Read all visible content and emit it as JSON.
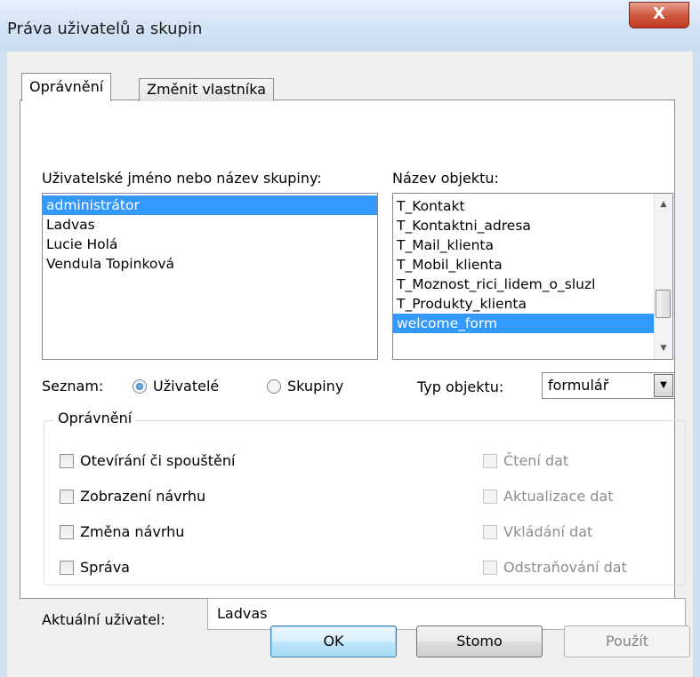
{
  "window": {
    "title": "Práva uživatelů a skupin",
    "close_glyph": "X"
  },
  "tabs": [
    {
      "label": "Oprávnění",
      "active": true
    },
    {
      "label": "Změnit vlastníka",
      "active": false
    }
  ],
  "users": {
    "label": "Uživatelské jméno nebo název skupiny:",
    "items": [
      "administrátor",
      "Ladvas",
      "Lucie Holá",
      "Vendula Topinková"
    ],
    "selected_index": 0
  },
  "objects": {
    "label": "Název objektu:",
    "items": [
      "T_Kontakt",
      "T_Kontaktni_adresa",
      "T_Mail_klienta",
      "T_Mobil_klienta",
      "T_Moznost_rici_lidem_o_sluzl",
      "T_Produkty_klienta",
      "welcome_form"
    ],
    "selected_index": 6
  },
  "list_filter": {
    "label": "Seznam:",
    "options": [
      {
        "label": "Uživatelé",
        "selected": true
      },
      {
        "label": "Skupiny",
        "selected": false
      }
    ]
  },
  "object_type": {
    "label": "Typ objektu:",
    "value": "formulář"
  },
  "permissions": {
    "legend": "Oprávnění",
    "left": [
      {
        "label": "Otevírání či spouštění",
        "checked": false,
        "enabled": true
      },
      {
        "label": "Zobrazení návrhu",
        "checked": false,
        "enabled": true
      },
      {
        "label": "Změna návrhu",
        "checked": false,
        "enabled": true
      },
      {
        "label": "Správa",
        "checked": false,
        "enabled": true
      }
    ],
    "right": [
      {
        "label": "Čtení dat",
        "checked": false,
        "enabled": false
      },
      {
        "label": "Aktualizace dat",
        "checked": false,
        "enabled": false
      },
      {
        "label": "Vkládání dat",
        "checked": false,
        "enabled": false
      },
      {
        "label": "Odstraňování dat",
        "checked": false,
        "enabled": false
      }
    ]
  },
  "current_user": {
    "label": "Aktuální uživatel:",
    "value": "Ladvas"
  },
  "buttons": {
    "ok": "OK",
    "cancel": "Stomo",
    "apply": "Použít"
  },
  "colors": {
    "selection": "#3399ff",
    "titlebar": "#d2e3f5",
    "close_button": "#c9462a"
  },
  "icons": {
    "close": "close-icon",
    "scroll_up": "chevron-up-icon",
    "scroll_down": "chevron-down-icon",
    "combo": "chevron-down-icon"
  }
}
